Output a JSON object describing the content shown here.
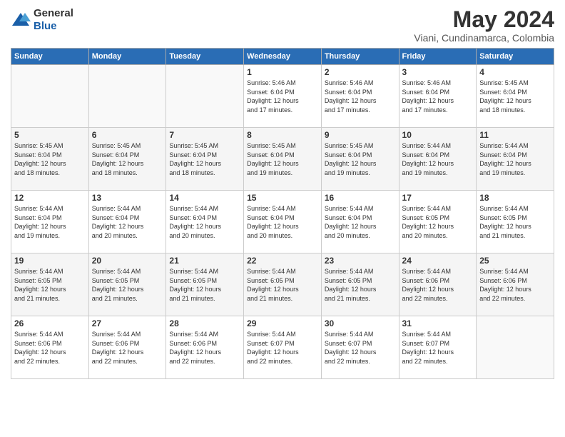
{
  "header": {
    "logo_general": "General",
    "logo_blue": "Blue",
    "month_year": "May 2024",
    "location": "Viani, Cundinamarca, Colombia"
  },
  "weekdays": [
    "Sunday",
    "Monday",
    "Tuesday",
    "Wednesday",
    "Thursday",
    "Friday",
    "Saturday"
  ],
  "weeks": [
    [
      {
        "day": "",
        "info": ""
      },
      {
        "day": "",
        "info": ""
      },
      {
        "day": "",
        "info": ""
      },
      {
        "day": "1",
        "info": "Sunrise: 5:46 AM\nSunset: 6:04 PM\nDaylight: 12 hours\nand 17 minutes."
      },
      {
        "day": "2",
        "info": "Sunrise: 5:46 AM\nSunset: 6:04 PM\nDaylight: 12 hours\nand 17 minutes."
      },
      {
        "day": "3",
        "info": "Sunrise: 5:46 AM\nSunset: 6:04 PM\nDaylight: 12 hours\nand 17 minutes."
      },
      {
        "day": "4",
        "info": "Sunrise: 5:45 AM\nSunset: 6:04 PM\nDaylight: 12 hours\nand 18 minutes."
      }
    ],
    [
      {
        "day": "5",
        "info": "Sunrise: 5:45 AM\nSunset: 6:04 PM\nDaylight: 12 hours\nand 18 minutes."
      },
      {
        "day": "6",
        "info": "Sunrise: 5:45 AM\nSunset: 6:04 PM\nDaylight: 12 hours\nand 18 minutes."
      },
      {
        "day": "7",
        "info": "Sunrise: 5:45 AM\nSunset: 6:04 PM\nDaylight: 12 hours\nand 18 minutes."
      },
      {
        "day": "8",
        "info": "Sunrise: 5:45 AM\nSunset: 6:04 PM\nDaylight: 12 hours\nand 19 minutes."
      },
      {
        "day": "9",
        "info": "Sunrise: 5:45 AM\nSunset: 6:04 PM\nDaylight: 12 hours\nand 19 minutes."
      },
      {
        "day": "10",
        "info": "Sunrise: 5:44 AM\nSunset: 6:04 PM\nDaylight: 12 hours\nand 19 minutes."
      },
      {
        "day": "11",
        "info": "Sunrise: 5:44 AM\nSunset: 6:04 PM\nDaylight: 12 hours\nand 19 minutes."
      }
    ],
    [
      {
        "day": "12",
        "info": "Sunrise: 5:44 AM\nSunset: 6:04 PM\nDaylight: 12 hours\nand 19 minutes."
      },
      {
        "day": "13",
        "info": "Sunrise: 5:44 AM\nSunset: 6:04 PM\nDaylight: 12 hours\nand 20 minutes."
      },
      {
        "day": "14",
        "info": "Sunrise: 5:44 AM\nSunset: 6:04 PM\nDaylight: 12 hours\nand 20 minutes."
      },
      {
        "day": "15",
        "info": "Sunrise: 5:44 AM\nSunset: 6:04 PM\nDaylight: 12 hours\nand 20 minutes."
      },
      {
        "day": "16",
        "info": "Sunrise: 5:44 AM\nSunset: 6:04 PM\nDaylight: 12 hours\nand 20 minutes."
      },
      {
        "day": "17",
        "info": "Sunrise: 5:44 AM\nSunset: 6:05 PM\nDaylight: 12 hours\nand 20 minutes."
      },
      {
        "day": "18",
        "info": "Sunrise: 5:44 AM\nSunset: 6:05 PM\nDaylight: 12 hours\nand 21 minutes."
      }
    ],
    [
      {
        "day": "19",
        "info": "Sunrise: 5:44 AM\nSunset: 6:05 PM\nDaylight: 12 hours\nand 21 minutes."
      },
      {
        "day": "20",
        "info": "Sunrise: 5:44 AM\nSunset: 6:05 PM\nDaylight: 12 hours\nand 21 minutes."
      },
      {
        "day": "21",
        "info": "Sunrise: 5:44 AM\nSunset: 6:05 PM\nDaylight: 12 hours\nand 21 minutes."
      },
      {
        "day": "22",
        "info": "Sunrise: 5:44 AM\nSunset: 6:05 PM\nDaylight: 12 hours\nand 21 minutes."
      },
      {
        "day": "23",
        "info": "Sunrise: 5:44 AM\nSunset: 6:05 PM\nDaylight: 12 hours\nand 21 minutes."
      },
      {
        "day": "24",
        "info": "Sunrise: 5:44 AM\nSunset: 6:06 PM\nDaylight: 12 hours\nand 22 minutes."
      },
      {
        "day": "25",
        "info": "Sunrise: 5:44 AM\nSunset: 6:06 PM\nDaylight: 12 hours\nand 22 minutes."
      }
    ],
    [
      {
        "day": "26",
        "info": "Sunrise: 5:44 AM\nSunset: 6:06 PM\nDaylight: 12 hours\nand 22 minutes."
      },
      {
        "day": "27",
        "info": "Sunrise: 5:44 AM\nSunset: 6:06 PM\nDaylight: 12 hours\nand 22 minutes."
      },
      {
        "day": "28",
        "info": "Sunrise: 5:44 AM\nSunset: 6:06 PM\nDaylight: 12 hours\nand 22 minutes."
      },
      {
        "day": "29",
        "info": "Sunrise: 5:44 AM\nSunset: 6:07 PM\nDaylight: 12 hours\nand 22 minutes."
      },
      {
        "day": "30",
        "info": "Sunrise: 5:44 AM\nSunset: 6:07 PM\nDaylight: 12 hours\nand 22 minutes."
      },
      {
        "day": "31",
        "info": "Sunrise: 5:44 AM\nSunset: 6:07 PM\nDaylight: 12 hours\nand 22 minutes."
      },
      {
        "day": "",
        "info": ""
      }
    ]
  ]
}
